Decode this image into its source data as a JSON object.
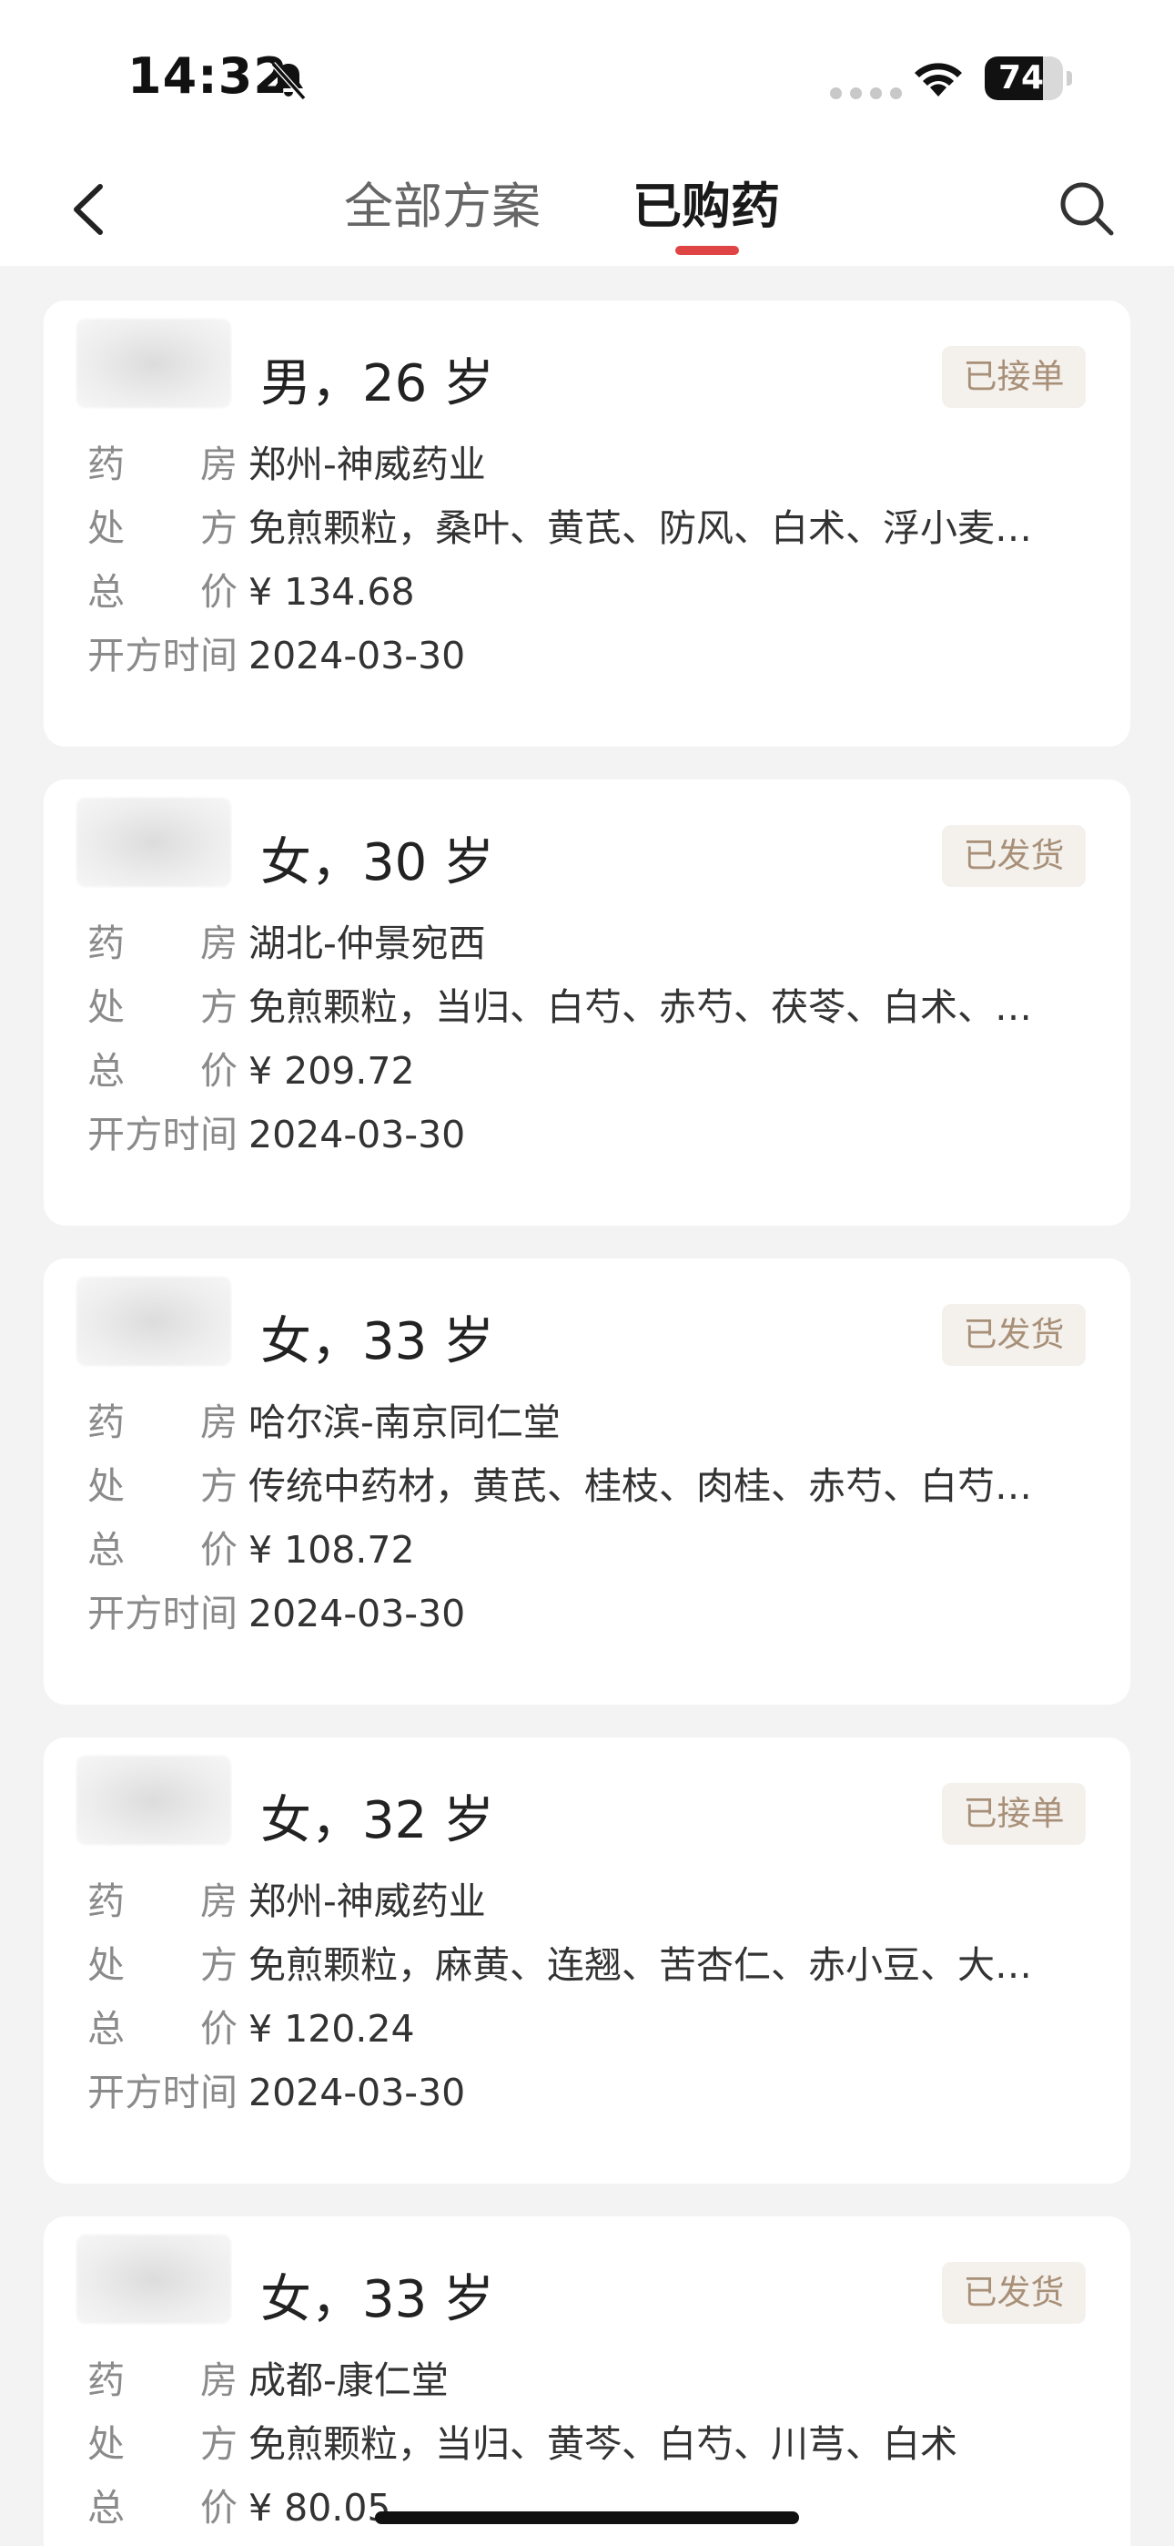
{
  "status_bar": {
    "time": "14:32",
    "battery": "74",
    "battery_level": 0.74,
    "icons": [
      "bell-slash-icon",
      "signal-dots-icon",
      "wifi-icon",
      "battery-icon"
    ]
  },
  "nav": {
    "back_icon": "chevron-left-icon",
    "tabs": [
      {
        "label": "全部方案",
        "active": false
      },
      {
        "label": "已购药",
        "active": true
      }
    ],
    "search_icon": "search-icon",
    "accent_color": "#e04545"
  },
  "labels": {
    "pharmacy": "药房",
    "prescription": "处方",
    "total": "总价",
    "time": "开方时间"
  },
  "orders": [
    {
      "patient": "男，26 岁",
      "status": "已接单",
      "pharmacy": "郑州-神威药业",
      "prescription": "免煎颗粒，桑叶、黄芪、防风、白术、浮小麦…",
      "total": "¥ 134.68",
      "date": "2024-03-30"
    },
    {
      "patient": "女，30 岁",
      "status": "已发货",
      "pharmacy": "湖北-仲景宛西",
      "prescription": "免煎颗粒，当归、白芍、赤芍、茯苓、白术、…",
      "total": "¥ 209.72",
      "date": "2024-03-30"
    },
    {
      "patient": "女，33 岁",
      "status": "已发货",
      "pharmacy": "哈尔滨-南京同仁堂",
      "prescription": "传统中药材，黄芪、桂枝、肉桂、赤芍、白芍…",
      "total": "¥ 108.72",
      "date": "2024-03-30"
    },
    {
      "patient": "女，32 岁",
      "status": "已接单",
      "pharmacy": "郑州-神威药业",
      "prescription": "免煎颗粒，麻黄、连翘、苦杏仁、赤小豆、大…",
      "total": "¥ 120.24",
      "date": "2024-03-30"
    },
    {
      "patient": "女，33 岁",
      "status": "已发货",
      "pharmacy": "成都-康仁堂",
      "prescription": "免煎颗粒，当归、黄芩、白芍、川芎、白术",
      "total": "¥ 80.05",
      "date": ""
    }
  ]
}
